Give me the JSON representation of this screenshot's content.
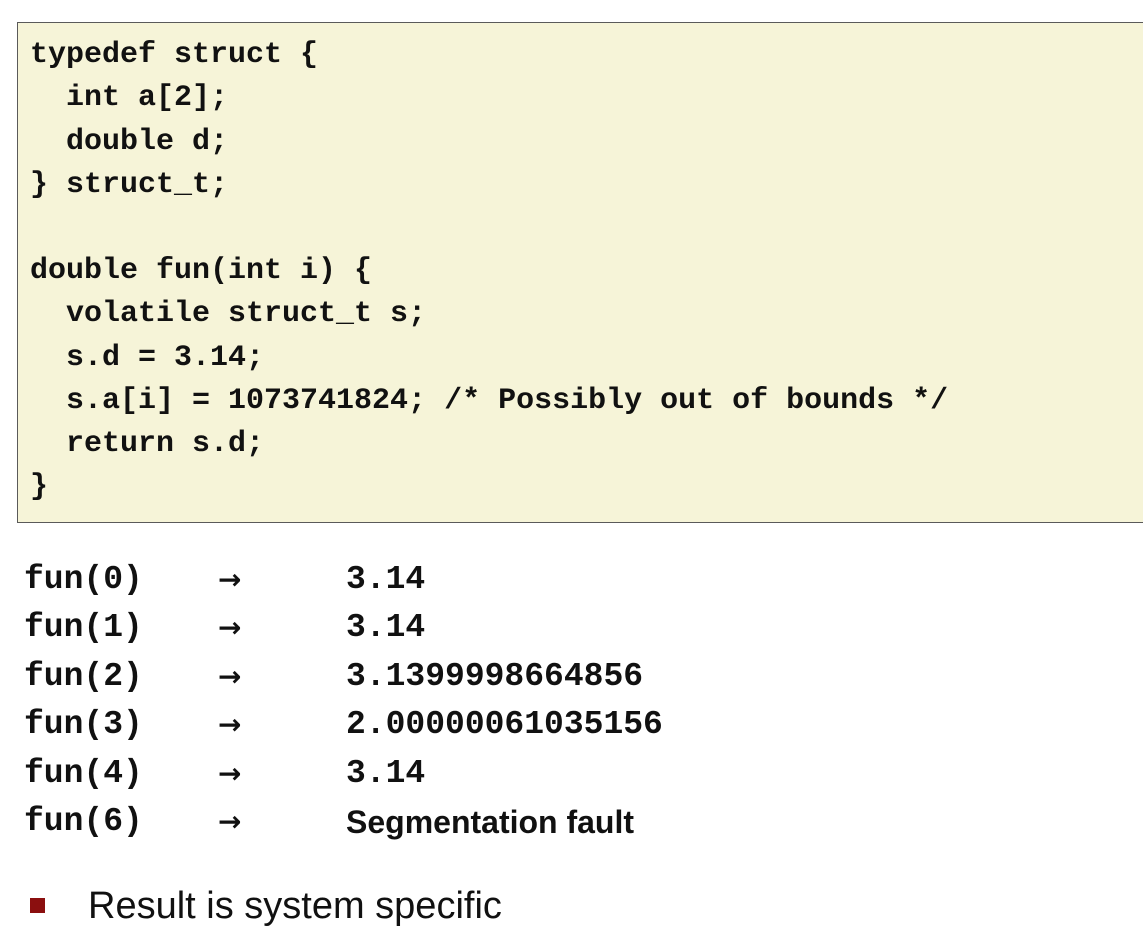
{
  "code": {
    "lines": [
      "typedef struct {",
      "  int a[2];",
      "  double d;",
      "} struct_t;",
      "",
      "double fun(int i) {",
      "  volatile struct_t s;",
      "  s.d = 3.14;",
      "  s.a[i] = 1073741824; /* Possibly out of bounds */",
      "  return s.d;",
      "}"
    ]
  },
  "results": {
    "arrow": "→",
    "rows": [
      {
        "call": "fun(0)",
        "value": "3.14"
      },
      {
        "call": "fun(1)",
        "value": "3.14"
      },
      {
        "call": "fun(2)",
        "value": "3.1399998664856"
      },
      {
        "call": "fun(3)",
        "value": "2.00000061035156"
      },
      {
        "call": "fun(4)",
        "value": "3.14"
      },
      {
        "call": "fun(6)",
        "value": "Segmentation fault"
      }
    ]
  },
  "bullets": [
    "Result is system specific"
  ],
  "colors": {
    "code_background": "#f6f4d8",
    "bullet": "#8b0f0f"
  }
}
